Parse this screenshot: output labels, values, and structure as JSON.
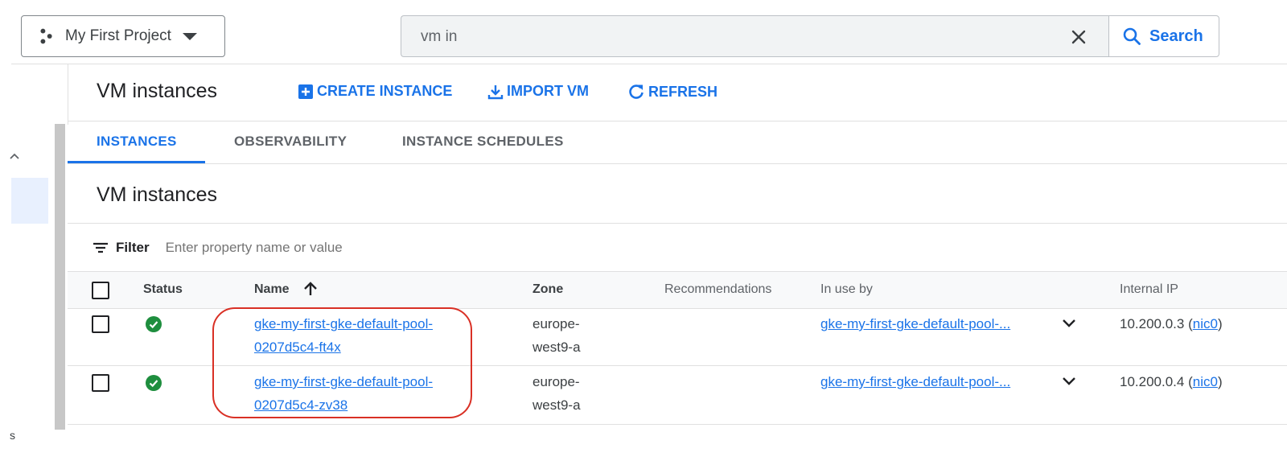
{
  "topbar": {
    "project_name": "My First Project",
    "search_value": "vm in",
    "search_button": "Search"
  },
  "header": {
    "title": "VM instances",
    "actions": [
      {
        "label": "CREATE INSTANCE",
        "icon": "add-box-icon"
      },
      {
        "label": "IMPORT VM",
        "icon": "download-icon"
      },
      {
        "label": "REFRESH",
        "icon": "refresh-icon"
      }
    ]
  },
  "tabs": [
    {
      "label": "INSTANCES",
      "active": true
    },
    {
      "label": "OBSERVABILITY",
      "active": false
    },
    {
      "label": "INSTANCE SCHEDULES",
      "active": false
    }
  ],
  "section": {
    "title": "VM instances",
    "filter_label": "Filter",
    "filter_placeholder": "Enter property name or value"
  },
  "table": {
    "columns": [
      "Status",
      "Name",
      "Zone",
      "Recommendations",
      "In use by",
      "Internal IP"
    ],
    "sort": {
      "column": "Name",
      "direction": "ascending"
    },
    "rows": [
      {
        "status": "running",
        "name_line1": "gke-my-first-gke-default-pool-",
        "name_line2": "0207d5c4-ft4x",
        "zone_line1": "europe-",
        "zone_line2": "west9-a",
        "recommendations": "",
        "in_use_by": "gke-my-first-gke-default-pool-...",
        "ip": "10.200.0.3 (",
        "nic": "nic0",
        "ip_close": ")"
      },
      {
        "status": "running",
        "name_line1": "gke-my-first-gke-default-pool-",
        "name_line2": "0207d5c4-zv38",
        "zone_line1": "europe-",
        "zone_line2": "west9-a",
        "recommendations": "",
        "in_use_by": "gke-my-first-gke-default-pool-...",
        "ip": "10.200.0.4 (",
        "nic": "nic0",
        "ip_close": ")"
      }
    ]
  },
  "left_rail": {
    "letter": "s"
  },
  "colors": {
    "accent": "#1a73e8",
    "status_ok": "#1e8e3e",
    "annotation": "#d93025"
  }
}
